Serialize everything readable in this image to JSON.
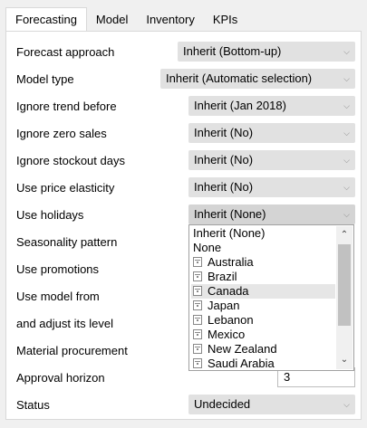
{
  "tabs": [
    "Forecasting",
    "Model",
    "Inventory",
    "KPIs"
  ],
  "rows": {
    "forecast_approach": {
      "label": "Forecast approach",
      "value": "Inherit (Bottom-up)"
    },
    "model_type": {
      "label": "Model type",
      "value": "Inherit (Automatic selection)"
    },
    "ignore_trend": {
      "label": "Ignore trend before",
      "value": "Inherit (Jan 2018)"
    },
    "ignore_zero": {
      "label": "Ignore zero sales",
      "value": "Inherit (No)"
    },
    "ignore_stockout": {
      "label": "Ignore stockout days",
      "value": "Inherit (No)"
    },
    "price_elasticity": {
      "label": "Use price elasticity",
      "value": "Inherit (No)"
    },
    "holidays": {
      "label": "Use holidays",
      "value": "Inherit (None)"
    },
    "seasonality": {
      "label": "Seasonality pattern"
    },
    "promotions": {
      "label": "Use promotions"
    },
    "model_from": {
      "label": "Use model from"
    },
    "adjust_level": {
      "label": "and adjust its level"
    },
    "material": {
      "label": "Material procurement"
    },
    "approval": {
      "label": "Approval horizon",
      "value": "3"
    },
    "status": {
      "label": "Status",
      "value": "Undecided"
    }
  },
  "holiday_options": {
    "inherit": "Inherit (None)",
    "none": "None",
    "countries": [
      "Australia",
      "Brazil",
      "Canada",
      "Japan",
      "Lebanon",
      "Mexico",
      "New Zealand",
      "Saudi Arabia"
    ],
    "selected": "Canada"
  },
  "icons": {
    "dropdown": "chevron-down-icon",
    "flag": "flag-icon"
  }
}
